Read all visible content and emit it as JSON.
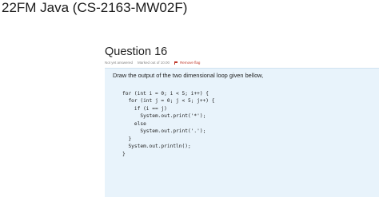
{
  "header": {
    "course_title": "22FM Java (CS-2163-MW02F)"
  },
  "question": {
    "title": "Question 16",
    "status": "Not yet answered",
    "marks": "Marked out of 10.00",
    "flag_label": "Remove flag",
    "prompt": "Draw the output of the two dimensional loop given bellow,",
    "code_lines": [
      "for (int i = 0; i < 5; i++) {",
      "  for (int j = 0; j < 5; j++) {",
      "    if (i == j)",
      "      System.out.print('*');",
      "    else",
      "      System.out.print('.');",
      "  }",
      "  System.out.println();",
      "}"
    ]
  },
  "colors": {
    "question_box_bg": "#e8f3fb",
    "flag": "#c0392b"
  }
}
